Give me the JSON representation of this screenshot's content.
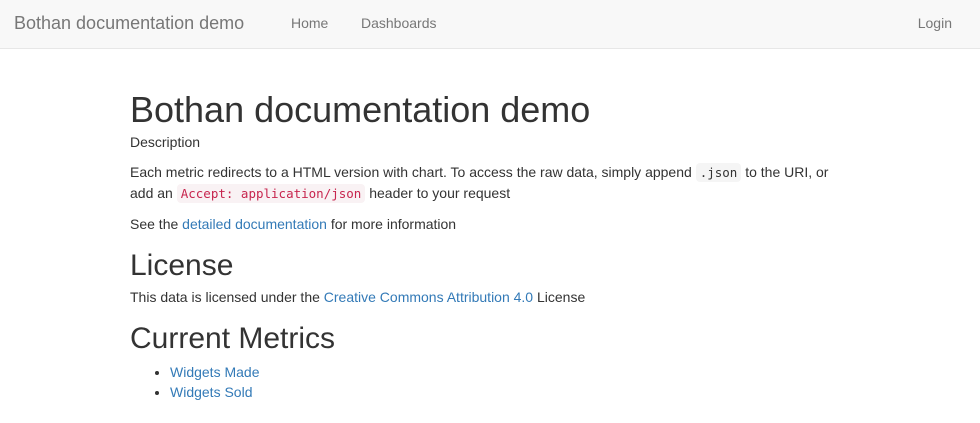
{
  "navbar": {
    "brand": "Bothan documentation demo",
    "links": [
      "Home",
      "Dashboards"
    ],
    "login": "Login"
  },
  "main": {
    "title": "Bothan documentation demo",
    "description_label": "Description",
    "para1": {
      "text_a": "Each metric redirects to a HTML version with chart. To access the raw data, simply append ",
      "code_a": ".json",
      "text_b": " to the URI, or add an ",
      "code_b": "Accept: application/json",
      "text_c": " header to your request"
    },
    "para2": {
      "text_a": "See the ",
      "link": "detailed documentation",
      "text_b": " for more information"
    },
    "license": {
      "heading": "License",
      "text_a": "This data is licensed under the ",
      "link": "Creative Commons Attribution 4.0",
      "text_b": " License"
    },
    "metrics": {
      "heading": "Current Metrics",
      "items": [
        "Widgets Made",
        "Widgets Sold"
      ]
    }
  }
}
